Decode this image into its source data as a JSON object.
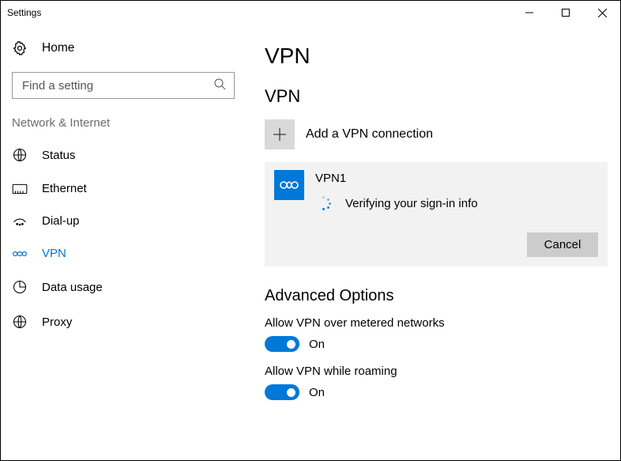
{
  "window": {
    "title": "Settings"
  },
  "sidebar": {
    "home_label": "Home",
    "search_placeholder": "Find a setting",
    "category": "Network & Internet",
    "items": [
      {
        "label": "Status"
      },
      {
        "label": "Ethernet"
      },
      {
        "label": "Dial-up"
      },
      {
        "label": "VPN"
      },
      {
        "label": "Data usage"
      },
      {
        "label": "Proxy"
      }
    ]
  },
  "main": {
    "title": "VPN",
    "section_title": "VPN",
    "add_label": "Add a VPN connection",
    "connection": {
      "name": "VPN1",
      "status": "Verifying your sign-in info",
      "cancel_label": "Cancel"
    },
    "advanced": {
      "title": "Advanced Options",
      "options": [
        {
          "label": "Allow VPN over metered networks",
          "state": "On"
        },
        {
          "label": "Allow VPN while roaming",
          "state": "On"
        }
      ]
    }
  }
}
